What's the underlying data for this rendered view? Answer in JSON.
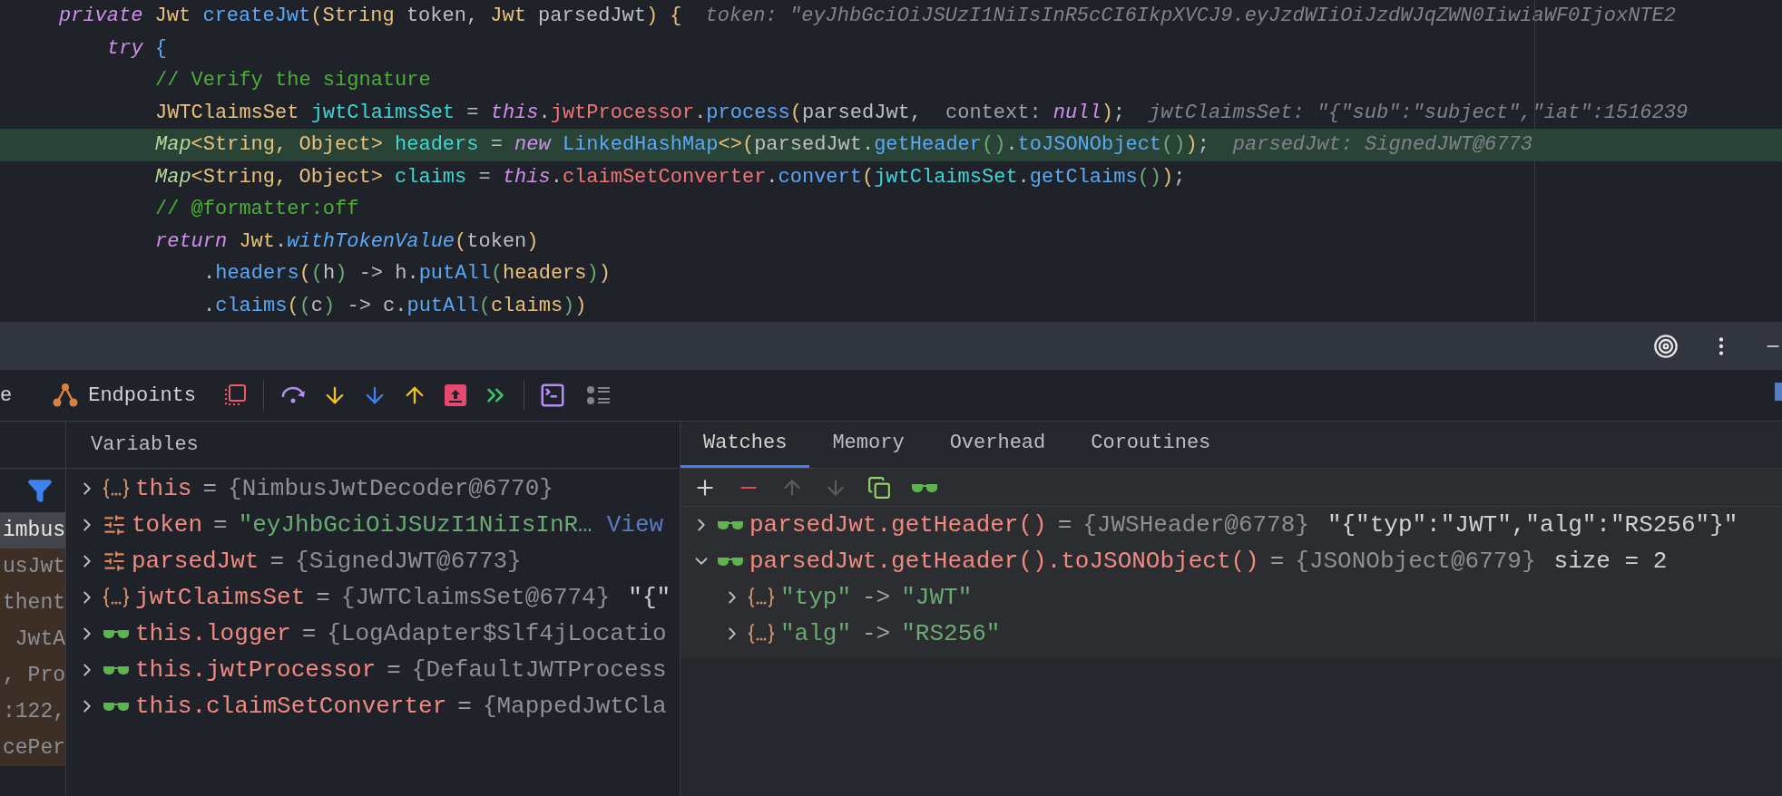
{
  "code": {
    "lines": [
      {
        "current": false,
        "tokens": [
          {
            "kind": "kw",
            "text": "private"
          },
          {
            "kind": "type",
            "text": " Jwt"
          },
          {
            "kind": "method",
            "text": " createJwt"
          },
          {
            "kind": "paren1",
            "text": "("
          },
          {
            "kind": "type",
            "text": "String"
          },
          {
            "kind": "plain",
            "text": " token, "
          },
          {
            "kind": "type",
            "text": "Jwt"
          },
          {
            "kind": "plain",
            "text": " parsedJwt"
          },
          {
            "kind": "paren1",
            "text": ") {"
          },
          {
            "kind": "hint",
            "text": "token: \"eyJhbGciOiJSUzI1NiIsInR5cCI6IkpXVCJ9.eyJzdWIiOiJzdWJqZWN0IiwiaWF0IjoxNTE2"
          }
        ],
        "children": [
          {
            "current": false,
            "tokens": [
              {
                "kind": "kw",
                "text": "try"
              },
              {
                "kind": "method",
                "text": " {"
              }
            ],
            "children": [
              {
                "current": false,
                "tokens": [
                  {
                    "kind": "comment",
                    "text": "// Verify the signature"
                  }
                ]
              },
              {
                "current": false,
                "tokens": [
                  {
                    "kind": "type",
                    "text": "JWTClaimsSet"
                  },
                  {
                    "kind": "var",
                    "text": " jwtClaimsSet"
                  },
                  {
                    "kind": "plain",
                    "text": " = "
                  },
                  {
                    "kind": "kw",
                    "text": "this"
                  },
                  {
                    "kind": "plain",
                    "text": "."
                  },
                  {
                    "kind": "field",
                    "text": "jwtProcessor"
                  },
                  {
                    "kind": "plain",
                    "text": "."
                  },
                  {
                    "kind": "method",
                    "text": "process"
                  },
                  {
                    "kind": "paren1",
                    "text": "("
                  },
                  {
                    "kind": "plain",
                    "text": "parsedJwt,"
                  },
                  {
                    "kind": "param",
                    "text": "context:"
                  },
                  {
                    "kind": "kw",
                    "text": " null"
                  },
                  {
                    "kind": "paren1",
                    "text": ")"
                  },
                  {
                    "kind": "plain",
                    "text": ";"
                  },
                  {
                    "kind": "hint",
                    "text": "jwtClaimsSet: \"{\"sub\":\"subject\",\"iat\":1516239"
                  }
                ]
              },
              {
                "current": true,
                "tokens": [
                  {
                    "kind": "iface",
                    "text": "Map"
                  },
                  {
                    "kind": "type",
                    "text": "<String, Object>"
                  },
                  {
                    "kind": "var",
                    "text": " headers"
                  },
                  {
                    "kind": "plain",
                    "text": " = "
                  },
                  {
                    "kind": "kw",
                    "text": "new"
                  },
                  {
                    "kind": "method",
                    "text": " LinkedHashMap"
                  },
                  {
                    "kind": "type",
                    "text": "<>"
                  },
                  {
                    "kind": "paren1",
                    "text": "("
                  },
                  {
                    "kind": "plain",
                    "text": "parsedJwt."
                  },
                  {
                    "kind": "method",
                    "text": "getHeader"
                  },
                  {
                    "kind": "paren2",
                    "text": "()"
                  },
                  {
                    "kind": "plain",
                    "text": "."
                  },
                  {
                    "kind": "method",
                    "text": "toJSONObject"
                  },
                  {
                    "kind": "paren2",
                    "text": "()"
                  },
                  {
                    "kind": "paren1",
                    "text": ")"
                  },
                  {
                    "kind": "plain",
                    "text": ";"
                  },
                  {
                    "kind": "hint",
                    "text": "parsedJwt: SignedJWT@6773"
                  }
                ]
              },
              {
                "current": false,
                "tokens": [
                  {
                    "kind": "iface",
                    "text": "Map"
                  },
                  {
                    "kind": "type",
                    "text": "<String, Object>"
                  },
                  {
                    "kind": "var",
                    "text": " claims"
                  },
                  {
                    "kind": "plain",
                    "text": " = "
                  },
                  {
                    "kind": "kw",
                    "text": "this"
                  },
                  {
                    "kind": "plain",
                    "text": "."
                  },
                  {
                    "kind": "field",
                    "text": "claimSetConverter"
                  },
                  {
                    "kind": "plain",
                    "text": "."
                  },
                  {
                    "kind": "method",
                    "text": "convert"
                  },
                  {
                    "kind": "paren1",
                    "text": "("
                  },
                  {
                    "kind": "var",
                    "text": "jwtClaimsSet"
                  },
                  {
                    "kind": "plain",
                    "text": "."
                  },
                  {
                    "kind": "method",
                    "text": "getClaims"
                  },
                  {
                    "kind": "paren2",
                    "text": "()"
                  },
                  {
                    "kind": "paren1",
                    "text": ")"
                  },
                  {
                    "kind": "plain",
                    "text": ";"
                  }
                ]
              },
              {
                "current": false,
                "tokens": [
                  {
                    "kind": "comment",
                    "text": "// @formatter:off"
                  }
                ]
              },
              {
                "current": false,
                "tokens": [
                  {
                    "kind": "kw",
                    "text": "return"
                  },
                  {
                    "kind": "type",
                    "text": " Jwt"
                  },
                  {
                    "kind": "plain",
                    "text": "."
                  },
                  {
                    "kind": "static",
                    "text": "withTokenValue"
                  },
                  {
                    "kind": "paren1",
                    "text": "("
                  },
                  {
                    "kind": "plain",
                    "text": "token"
                  },
                  {
                    "kind": "paren1",
                    "text": ")"
                  }
                ],
                "children": [
                  {
                    "current": false,
                    "tokens": [
                      {
                        "kind": "plain",
                        "text": "."
                      },
                      {
                        "kind": "method",
                        "text": "headers"
                      },
                      {
                        "kind": "paren1",
                        "text": "("
                      },
                      {
                        "kind": "paren2",
                        "text": "("
                      },
                      {
                        "kind": "plain",
                        "text": "h"
                      },
                      {
                        "kind": "paren2",
                        "text": ")"
                      },
                      {
                        "kind": "plain",
                        "text": " -> h."
                      },
                      {
                        "kind": "method",
                        "text": "putAll"
                      },
                      {
                        "kind": "paren2",
                        "text": "("
                      },
                      {
                        "kind": "type",
                        "text": "headers"
                      },
                      {
                        "kind": "paren2",
                        "text": ")"
                      },
                      {
                        "kind": "paren1",
                        "text": ")"
                      }
                    ]
                  },
                  {
                    "current": false,
                    "tokens": [
                      {
                        "kind": "plain",
                        "text": "."
                      },
                      {
                        "kind": "method",
                        "text": "claims"
                      },
                      {
                        "kind": "paren1",
                        "text": "("
                      },
                      {
                        "kind": "paren2",
                        "text": "("
                      },
                      {
                        "kind": "plain",
                        "text": "c"
                      },
                      {
                        "kind": "paren2",
                        "text": ")"
                      },
                      {
                        "kind": "plain",
                        "text": " -> c."
                      },
                      {
                        "kind": "method",
                        "text": "putAll"
                      },
                      {
                        "kind": "paren2",
                        "text": "("
                      },
                      {
                        "kind": "type",
                        "text": "claims"
                      },
                      {
                        "kind": "paren2",
                        "text": ")"
                      },
                      {
                        "kind": "paren1",
                        "text": ")"
                      }
                    ]
                  }
                ]
              }
            ]
          }
        ]
      }
    ]
  },
  "toolbar": {
    "tabs": [
      {
        "label": "e"
      },
      {
        "label": "Endpoints"
      }
    ]
  },
  "frames": [
    {
      "text": "imbus",
      "selected": true
    },
    {
      "text": "usJwt",
      "selected": false
    },
    {
      "text": "thent",
      "selected": false
    },
    {
      "text": " JwtA",
      "selected": false
    },
    {
      "text": ", Pro",
      "selected": false
    },
    {
      "text": ":122,",
      "selected": false
    },
    {
      "text": "cePer",
      "selected": false
    }
  ],
  "variables": {
    "title": "Variables",
    "items": [
      {
        "kind": "object",
        "expanded": false,
        "name": "this",
        "operator": "=",
        "value": "{NimbusJwtDecoder@6770}"
      },
      {
        "kind": "param",
        "expanded": false,
        "name": "token",
        "operator": "=",
        "string": "\"eyJhbGciOiJSUzI1NiIsInR…",
        "link": "View"
      },
      {
        "kind": "param",
        "expanded": false,
        "name": "parsedJwt",
        "operator": "=",
        "value": "{SignedJWT@6773}"
      },
      {
        "kind": "object",
        "expanded": false,
        "name": "jwtClaimsSet",
        "operator": "=",
        "value": "{JWTClaimsSet@6774}",
        "extra": "\"{\""
      },
      {
        "kind": "watch",
        "expanded": false,
        "name": "this.logger",
        "operator": "=",
        "value": "{LogAdapter$Slf4jLocatio"
      },
      {
        "kind": "watch",
        "expanded": false,
        "name": "this.jwtProcessor",
        "operator": "=",
        "value": "{DefaultJWTProcess"
      },
      {
        "kind": "watch",
        "expanded": false,
        "name": "this.claimSetConverter",
        "operator": "=",
        "value": "{MappedJwtCla"
      }
    ]
  },
  "watches": {
    "tabs": [
      {
        "label": "Watches",
        "selected": true
      },
      {
        "label": "Memory",
        "selected": false
      },
      {
        "label": "Overhead",
        "selected": false
      },
      {
        "label": "Coroutines",
        "selected": false
      }
    ],
    "items": [
      {
        "kind": "watch",
        "expanded": false,
        "name": "parsedJwt.getHeader()",
        "operator": "=",
        "value": "{JWSHeader@6778}",
        "extra": "\"{\"typ\":\"JWT\",\"alg\":\"RS256\"}\""
      },
      {
        "kind": "watch",
        "expanded": true,
        "name": "parsedJwt.getHeader().toJSONObject()",
        "operator": "=",
        "value": "{JSONObject@6779}",
        "extra": "size = 2",
        "children": [
          {
            "kind": "entry",
            "expanded": false,
            "name": "\"typ\"",
            "operator": "->",
            "string": "\"JWT\""
          },
          {
            "kind": "entry",
            "expanded": false,
            "name": "\"alg\"",
            "operator": "->",
            "string": "\"RS256\""
          }
        ]
      }
    ]
  }
}
